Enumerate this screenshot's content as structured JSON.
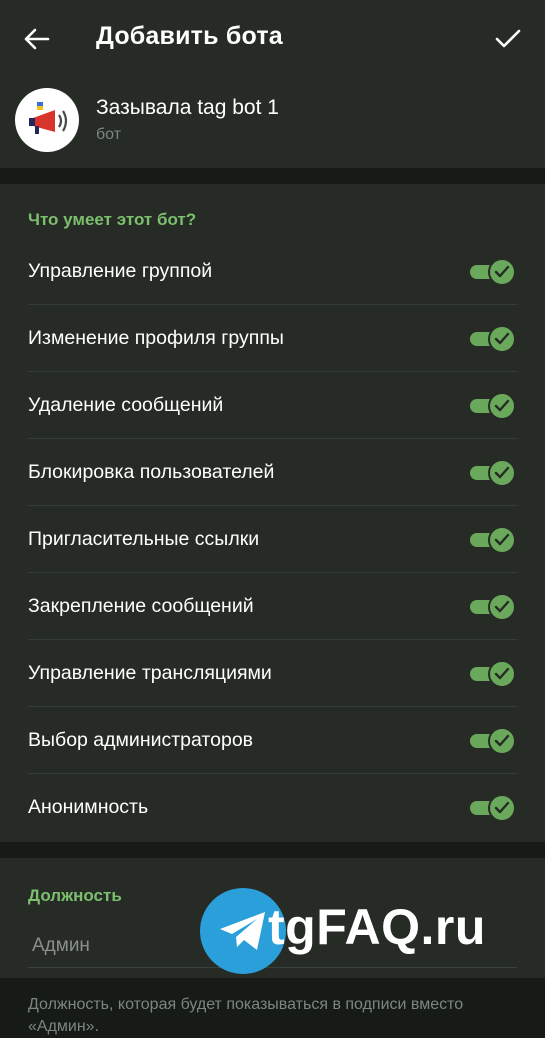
{
  "header": {
    "title": "Добавить бота",
    "back_icon": "arrow-left-icon",
    "confirm_icon": "check-icon"
  },
  "bot": {
    "name": "Зазывала tag bot 1",
    "status": "бот"
  },
  "permissions": {
    "title": "Что умеет этот бот?",
    "items": [
      {
        "label": "Управление группой",
        "enabled": true
      },
      {
        "label": "Изменение профиля группы",
        "enabled": true
      },
      {
        "label": "Удаление сообщений",
        "enabled": true
      },
      {
        "label": "Блокировка пользователей",
        "enabled": true
      },
      {
        "label": "Пригласительные ссылки",
        "enabled": true
      },
      {
        "label": "Закрепление сообщений",
        "enabled": true
      },
      {
        "label": "Управление трансляциями",
        "enabled": true
      },
      {
        "label": "Выбор администраторов",
        "enabled": true
      },
      {
        "label": "Анонимность",
        "enabled": true
      }
    ]
  },
  "role": {
    "title": "Должность",
    "placeholder": "Админ",
    "hint": "Должность, которая будет показываться в подписи вместо «Админ»."
  },
  "watermark": {
    "text": "tgFAQ.ru"
  },
  "colors": {
    "accent": "#7cbf6e",
    "toggle_on": "#6aa85c",
    "surface": "#262b26",
    "background": "#161b16",
    "watermark_blue": "#2a9fd9"
  }
}
